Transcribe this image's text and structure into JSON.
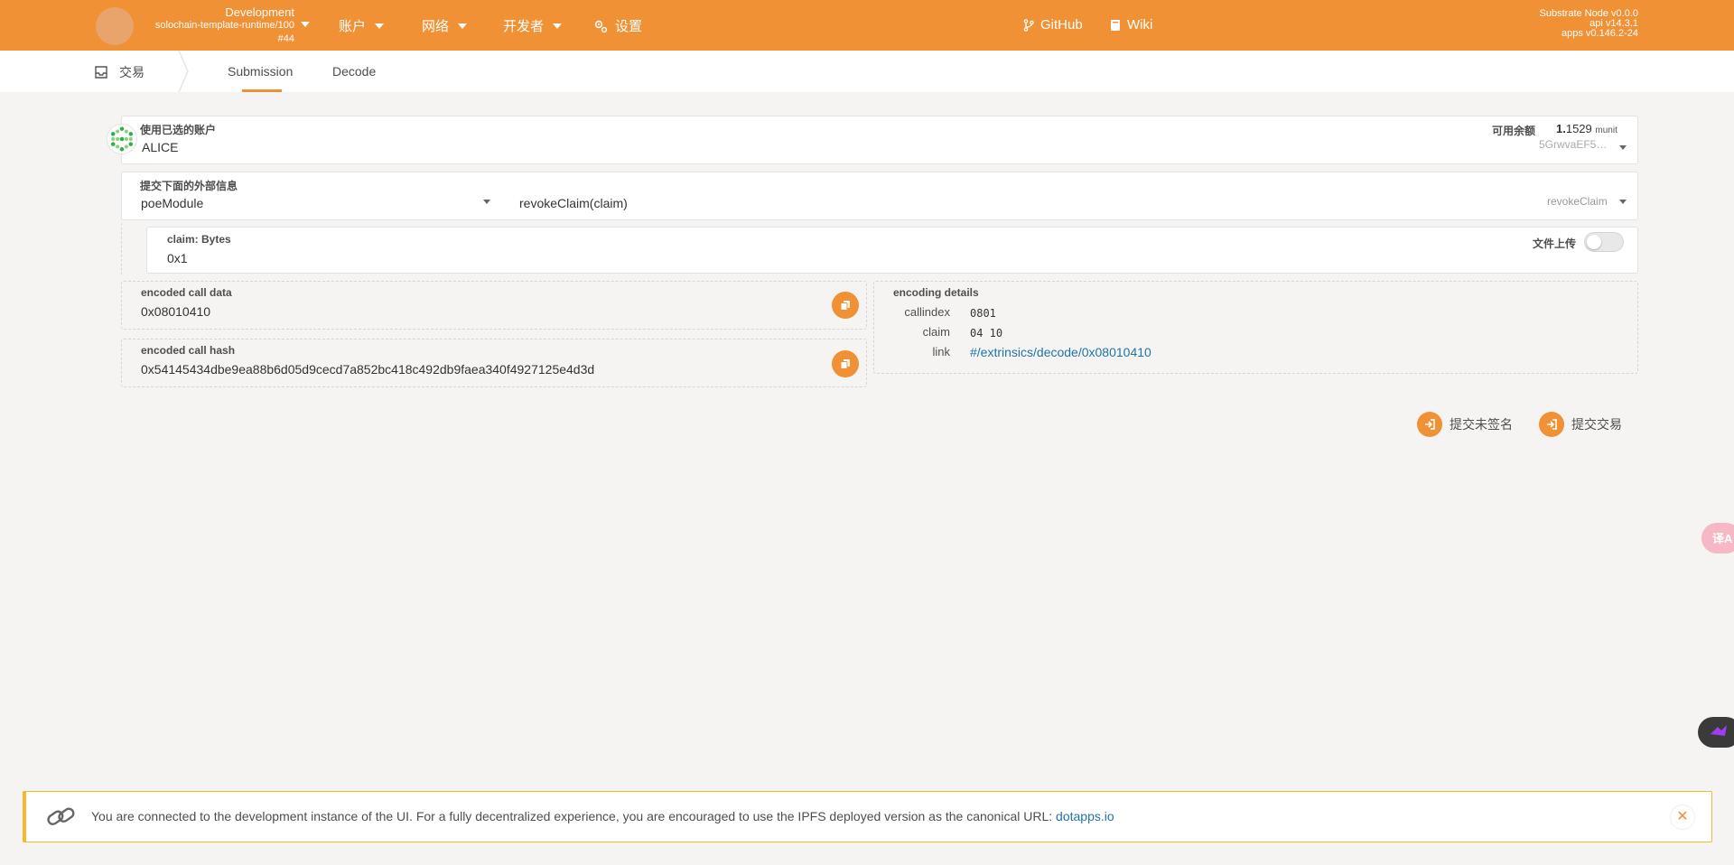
{
  "topbar": {
    "chain_name": "Development",
    "runtime": "solochain-template-runtime/100",
    "block": "#44",
    "nav": [
      "账户",
      "网络",
      "开发者"
    ],
    "settings_label": "设置",
    "github_label": "GitHub",
    "wiki_label": "Wiki",
    "version_node": "Substrate Node v0.0.0",
    "version_api": "api v14.3.1",
    "version_apps": "apps v0.146.2-24"
  },
  "subbar": {
    "section_label": "交易",
    "tabs": [
      "Submission",
      "Decode"
    ],
    "active_tab": "Submission"
  },
  "account": {
    "label": "使用已选的账户",
    "name": "ALICE",
    "balance_label": "可用余额",
    "balance_int": "1.",
    "balance_frac": "1529",
    "balance_unit": "munit",
    "address": "5GrwvaEF5…"
  },
  "extrinsic": {
    "label": "提交下面的外部信息",
    "module": "poeModule",
    "call": "revokeClaim(claim)",
    "call_short": "revokeClaim"
  },
  "param": {
    "label": "claim: Bytes",
    "value": "0x1",
    "upload_label": "文件上传"
  },
  "encoded_call_data": {
    "label": "encoded call data",
    "value": "0x08010410"
  },
  "encoded_call_hash": {
    "label": "encoded call hash",
    "value": "0x54145434dbe9ea88b6d05d9cecd7a852bc418c492db9faea340f4927125e4d3d"
  },
  "encoding_details": {
    "label": "encoding details",
    "callindex_key": "callindex",
    "callindex_val": "0801",
    "claim_key": "claim",
    "claim_val": "04 10",
    "link_key": "link",
    "link_val": "#/extrinsics/decode/0x08010410"
  },
  "actions": {
    "unsigned_label": "提交未签名",
    "submit_label": "提交交易"
  },
  "float": {
    "translate_label": "译A"
  },
  "banner": {
    "message": "You are connected to the development instance of the UI. For a fully decentralized experience, you are encouraged to use the IPFS deployed version as the canonical URL: ",
    "link_text": "dotapps.io",
    "close_label": "✕"
  },
  "colors": {
    "accent": "#f19135",
    "link": "#1f75a8",
    "banner_border": "#f7b830"
  }
}
